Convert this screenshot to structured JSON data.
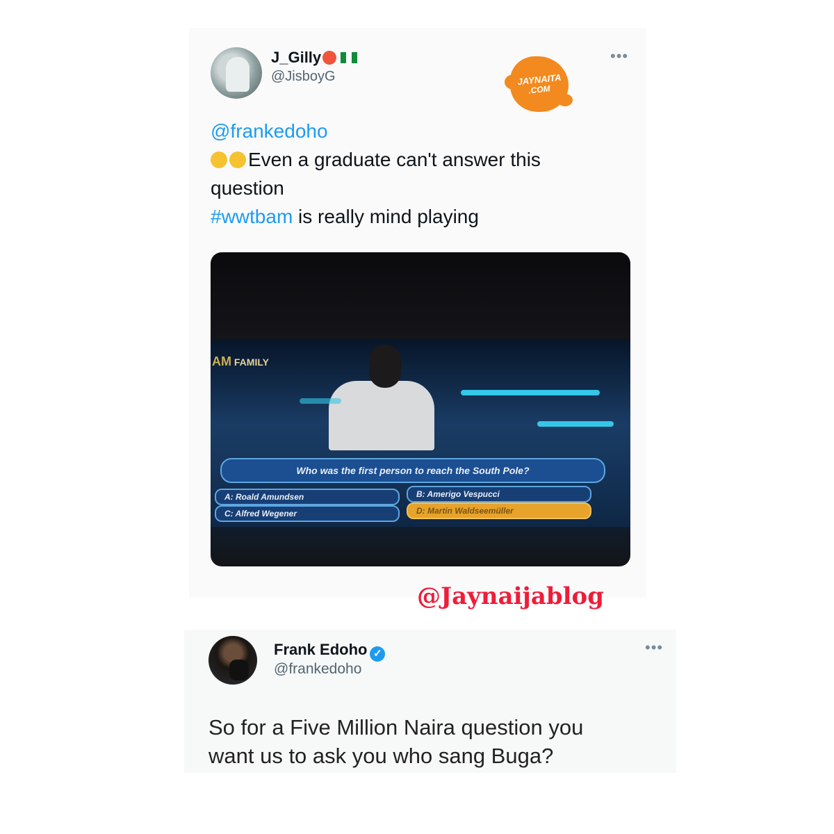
{
  "tweet1": {
    "display_name": "J_Gilly",
    "handle": "@JisboyG",
    "more": "•••",
    "mention": "@frankedoho",
    "line1": "Even a graduate can't answer this",
    "line2": "question",
    "hashtag": "#wwtbam",
    "line3_rest": " is really mind playing"
  },
  "logo": {
    "line1": "JAYNAITA",
    "line2": ".COM"
  },
  "media": {
    "channel_mark": "AM",
    "channel": "FAMILY",
    "question": "Who was the first person to reach the South Pole?",
    "answers": [
      "A: Roald Amundsen",
      "B: Amerigo Vespucci",
      "C: Alfred Wegener",
      "D: Martin Waldseemüller"
    ]
  },
  "watermark": "@Jaynaijablog",
  "tweet2": {
    "display_name": "Frank Edoho",
    "verified": "✓",
    "handle": "@frankedoho",
    "more": "•••",
    "text_line1": "So for a Five Million Naira question you",
    "text_line2": "want us to ask you who sang Buga?"
  }
}
